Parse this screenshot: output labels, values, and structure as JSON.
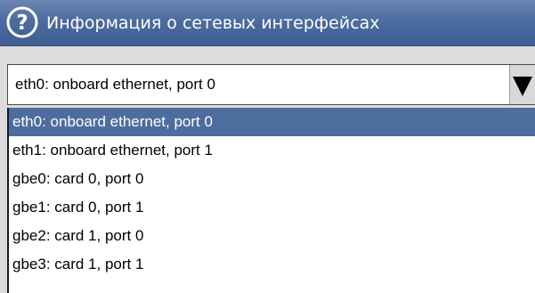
{
  "dialog": {
    "title": "Информация о сетевых интерфейсах"
  },
  "combo": {
    "value": "eth0: onboard ethernet, port 0"
  },
  "list": {
    "items": [
      {
        "label": "eth0: onboard ethernet, port 0",
        "selected": true
      },
      {
        "label": "eth1: onboard ethernet, port 1",
        "selected": false
      },
      {
        "label": "gbe0: card 0, port 0",
        "selected": false
      },
      {
        "label": "gbe1: card 0, port 1",
        "selected": false
      },
      {
        "label": "gbe2: card 1, port 0",
        "selected": false
      },
      {
        "label": "gbe3: card 1, port 1",
        "selected": false
      }
    ]
  },
  "colors": {
    "titlebar": "#4d6c9f",
    "selection": "#4e6d9f",
    "background": "#dcdcdc"
  },
  "icons": {
    "title": "help-icon",
    "combo": "chevron-down-icon"
  }
}
